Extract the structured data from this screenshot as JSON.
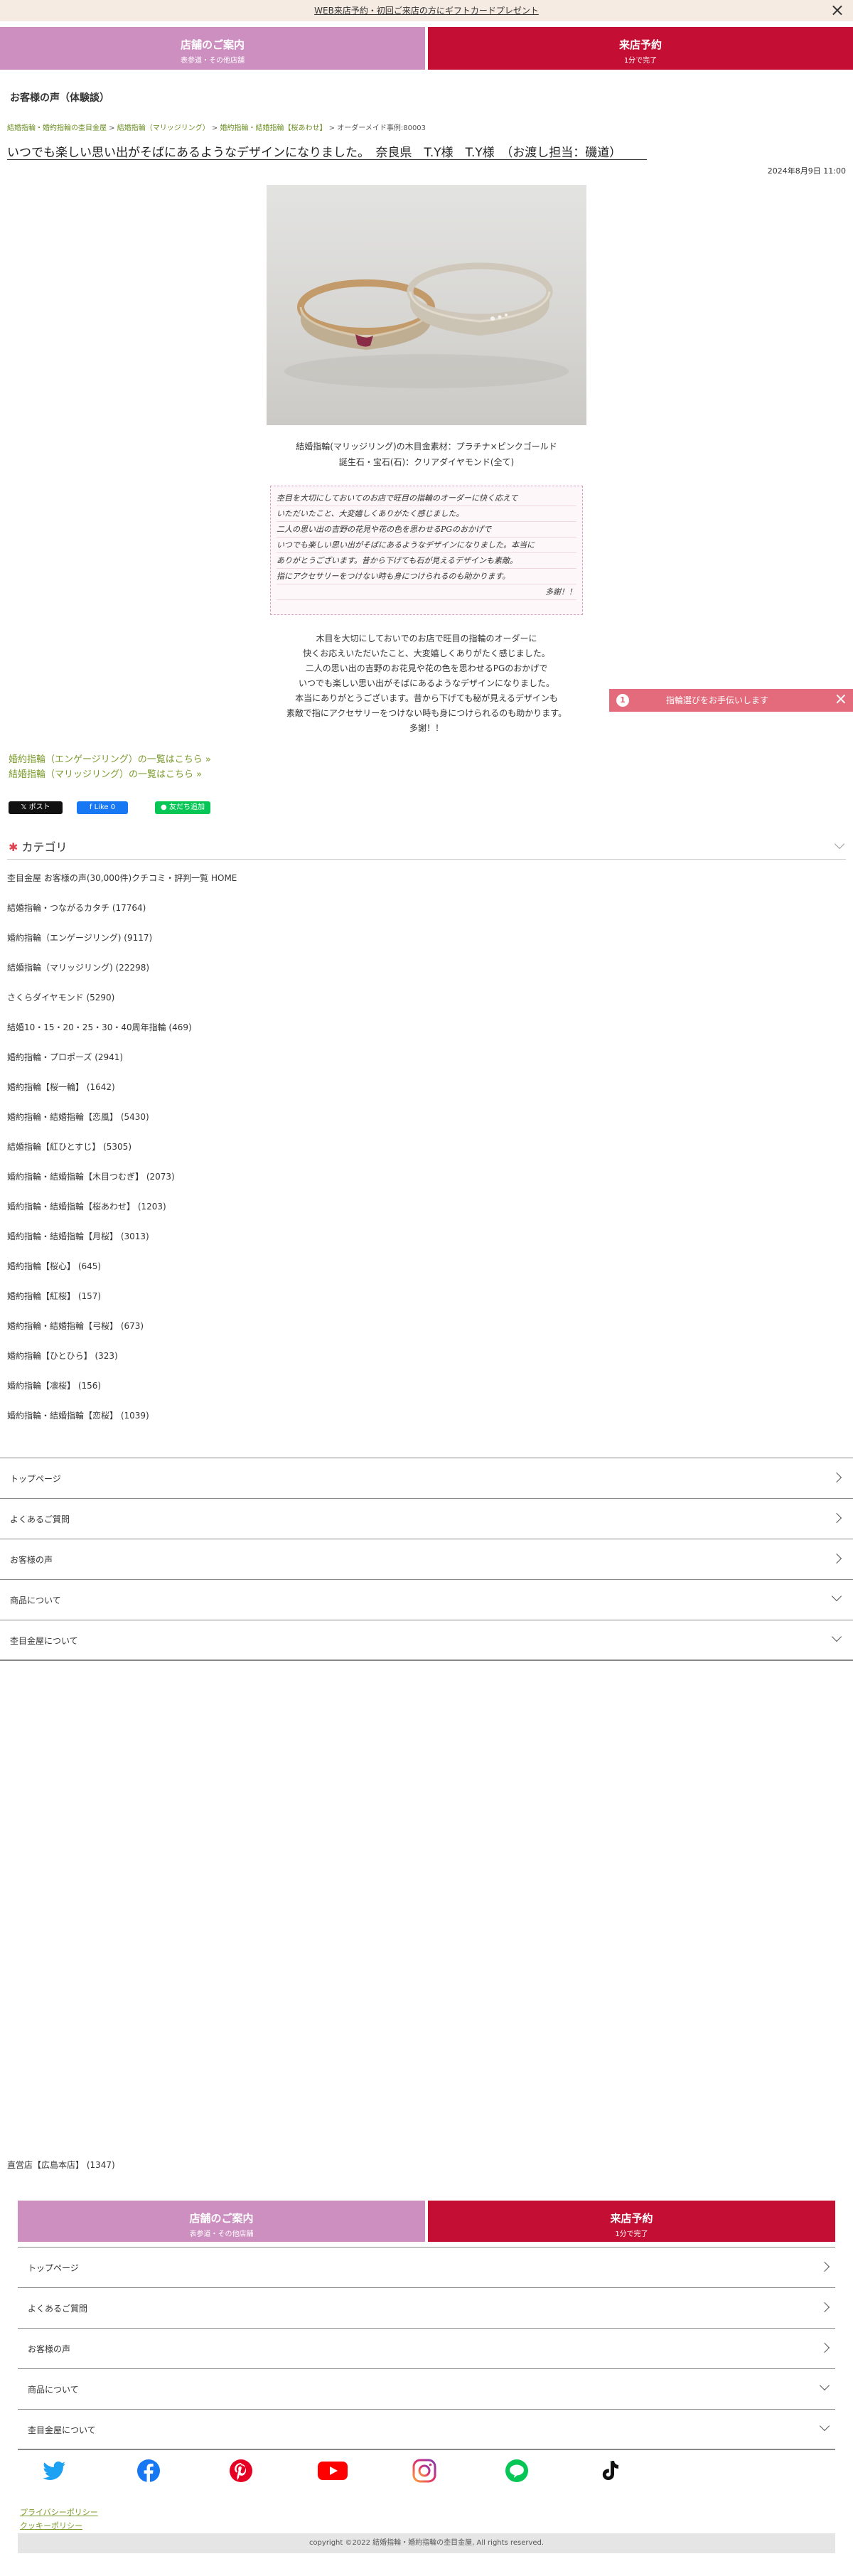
{
  "banner": {
    "text": "WEB来店予約・初回ご来店の方にギフトカードプレゼント"
  },
  "cta": {
    "store": {
      "title": "店舗のご案内",
      "sub": "表参道・その他店舗"
    },
    "visit": {
      "title": "来店予約",
      "sub": "1分で完了"
    }
  },
  "page": {
    "heading": "お客様の声（体験談）",
    "breadcrumb": [
      "結婚指輪・婚約指輪の杢目金屋",
      "結婚指輪（マリッジリング）",
      "婚約指輪・結婚指輪【桜あわせ】",
      "オーダーメイド事例:80003"
    ],
    "title": "いつでも楽しい思い出がそばにあるようなデザインになりました。　奈良県　T.Y様　T.Y様　（お渡し担当：磯道）",
    "date": "2024年8月9日 11:00"
  },
  "spec": {
    "line1": "結婚指輪(マリッジリング)の木目金素材：プラチナ×ピンクゴールド",
    "line2": "誕生石・宝石(石)：クリアダイヤモンド(全て)"
  },
  "handwritten": {
    "lines": [
      "杢目を大切にしておいてのお店で旺目の指輪のオーダーに快く応えて",
      "いただいたこと、大変嬉しくありがたく感じました。",
      "二人の思い出の吉野の花見や花の色を思わせるPGのおかげで",
      "いつでも楽しい思い出がそばにあるようなデザインになりました。本当に",
      "ありがとうございます。昔から下げても石が見えるデザインも素敵。",
      "指にアクセサリーをつけない時も身につけられるのも助かります。",
      "多謝！！"
    ]
  },
  "message": {
    "lines": [
      "木目を大切にしておいでのお店で旺目の指輪のオーダーに",
      "快くお応えいただいたこと、大変嬉しくありがたく感じました。",
      "二人の思い出の吉野のお花見や花の色を思わせるPGのおかげで",
      "いつでも楽しい思い出がそばにあるようなデザインになりました。",
      "本当にありがとうございます。昔から下げても秘が見えるデザインも",
      "素敵で指にアクセサリーをつけない時も身につけられるのも助かります。",
      "多謝！！"
    ]
  },
  "helper": {
    "badge": "1",
    "label": "指輪選びをお手伝いします"
  },
  "links": {
    "engagement": "婚約指輪（エンゲージリング）の一覧はこちら »",
    "marriage": "結婚指輪（マリッジリング）の一覧はこちら »"
  },
  "social": {
    "post": "ポスト",
    "like": "Like 0",
    "line": "友だち追加"
  },
  "category": {
    "title": "カテゴリ",
    "items": [
      "杢目金屋 お客様の声(30,000件)クチコミ・評判一覧 HOME",
      "結婚指輪・つながるカタチ (17764)",
      "婚約指輪（エンゲージリング) (9117)",
      "結婚指輪（マリッジリング) (22298)",
      "さくらダイヤモンド (5290)",
      "結婚10・15・20・25・30・40周年指輪 (469)",
      "婚約指輪・プロポーズ (2941)",
      "婚約指輪【桜一輪】 (1642)",
      "婚約指輪・結婚指輪【恋風】 (5430)",
      "結婚指輪【紅ひとすじ】 (5305)",
      "婚約指輪・結婚指輪【木目つむぎ】 (2073)",
      "婚約指輪・結婚指輪【桜あわせ】 (1203)",
      "婚約指輪・結婚指輪【月桜】 (3013)",
      "婚約指輪【桜心】 (645)",
      "婚約指輪【紅桜】 (157)",
      "婚約指輪・結婚指輪【弓桜】 (673)",
      "婚約指輪【ひとひら】 (323)",
      "婚約指輪【凛桜】 (156)",
      "婚約指輪・結婚指輪【恋桜】 (1039)"
    ]
  },
  "nav": {
    "items": [
      {
        "label": "トップページ",
        "kind": "link"
      },
      {
        "label": "よくあるご質問",
        "kind": "link"
      },
      {
        "label": "お客様の声",
        "kind": "link"
      },
      {
        "label": "商品について",
        "kind": "expand"
      },
      {
        "label": "杢目金屋について",
        "kind": "expand"
      }
    ]
  },
  "lower": {
    "clipped_item": "直営店【広島本店】 (1347)"
  },
  "footer": {
    "sns": [
      "twitter-icon",
      "facebook-icon",
      "pinterest-icon",
      "youtube-icon",
      "instagram-icon",
      "line-icon",
      "tiktok-icon"
    ],
    "privacy": "プライバシーポリシー",
    "cookie": "クッキーポリシー",
    "copyright": "copyright ©2022 結婚指輪・婚約指輪の杢目金屋, All rights reserved."
  },
  "colors": {
    "store": "#cc8fc0",
    "visit": "#c40e33",
    "link_green": "#7a9a2a",
    "helper": "#e46b7c"
  }
}
